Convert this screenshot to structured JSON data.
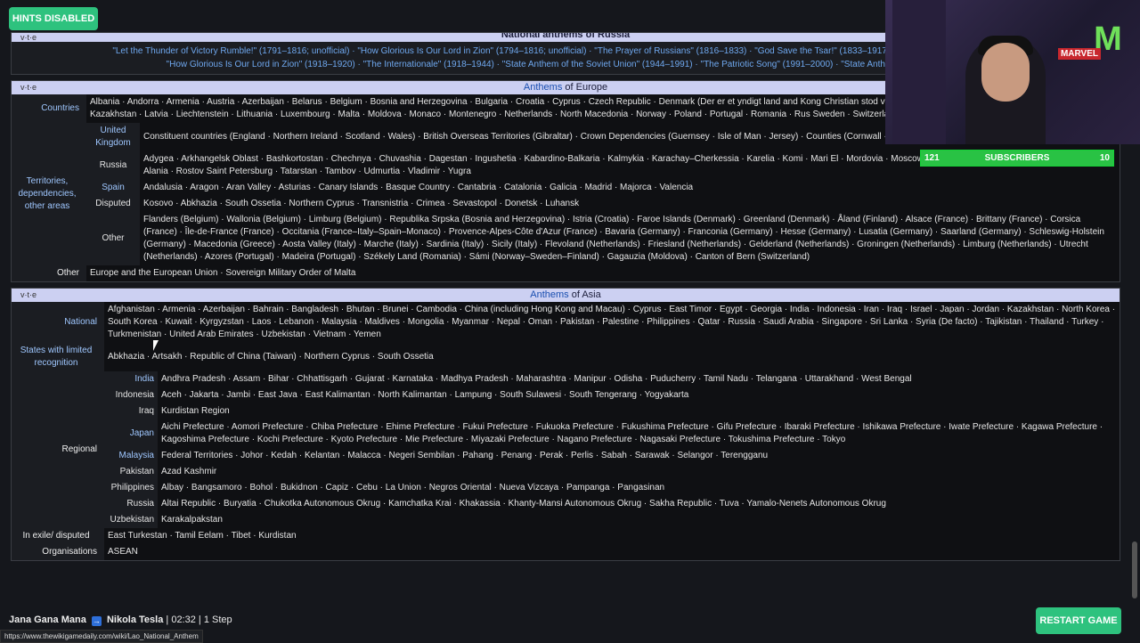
{
  "overlay": {
    "hints": "HINTS DISABLED",
    "restart": "RESTART GAME",
    "subs_left": "121",
    "subs_center": "SUBSCRIBERS",
    "subs_right": "10",
    "cam_logo": "M",
    "cam_marvel": "MARVEL"
  },
  "game": {
    "start": "Jana Gana Mana",
    "arrow": "→",
    "target": "Nikola Tesla",
    "rest": "| 02:32 | 1 Step"
  },
  "status_url": "https://www.thewikigamedaily.com/wiki/Lao_National_Anthem",
  "vte": "v·t·e",
  "russia": {
    "title": "National anthems of Russia",
    "line1": "\"Let the Thunder of Victory Rumble!\" (1791–1816; unofficial) · \"How Glorious Is Our Lord in Zion\" (1794–1816; unofficial) · \"The Prayer of Russians\" (1816–1833) · \"God Save the Tsar!\" (1833–1917) · \"Worker's Marseillaise\" (1917–",
    "line2": "\"How Glorious Is Our Lord in Zion\" (1918–1920) · \"The Internationale\" (1918–1944) · \"State Anthem of the Soviet Union\" (1944–1991) · \"The Patriotic Song\" (1991–2000) · \"State Anthem of the Russian F"
  },
  "europe": {
    "title_a": "Anthems",
    "title_b": "of Europe",
    "countries_label": "Countries",
    "countries": "Albania · Andorra · Armenia · Austria · Azerbaijan · Belarus · Belgium · Bosnia and Herzegovina · Bulgaria · Croatia · Cyprus · Czech Republic · Denmark (Der er et yndigt land and Kong Christian stod ved højen mast) Hungary · Iceland · Ireland · Italy · Kazakhstan · Latvia · Liechtenstein · Lithuania · Luxembourg · Malta · Moldova · Monaco · Montenegro · Netherlands · North Macedonia · Norway · Poland · Portugal · Romania · Rus Sweden · Switzerland · Turkey · Ukraine · United Kingdom · Vatican City",
    "territories_label": "Territories, dependencies, other areas",
    "uk_label": "United Kingdom",
    "uk": "Constituent countries (England · Northern Ireland · Scotland · Wales) · British Overseas Territories (Gibraltar) · Crown Dependencies (Guernsey · Isle of Man · Jersey) · Counties (Cornwall · Lincolnshire · Sussex",
    "russia_label": "Russia",
    "russia": "Adygea · Arkhangelsk Oblast · Bashkortostan · Chechnya · Chuvashia · Dagestan · Ingushetia · Kabardino-Balkaria · Kalmykia · Karachay–Cherkessia · Karelia · Komi · Mari El · Mordovia · Moscow · Nenets Autonomous Okrug · North Ossetia–Alania · Rostov Saint Petersburg · Tatarstan · Tambov · Udmurtia · Vladimir · Yugra",
    "spain_label": "Spain",
    "spain": "Andalusia · Aragon · Aran Valley · Asturias · Canary Islands · Basque Country · Cantabria · Catalonia · Galicia · Madrid · Majorca · Valencia",
    "disputed_label": "Disputed",
    "disputed": "Kosovo · Abkhazia · South Ossetia · Northern Cyprus · Transnistria · Crimea · Sevastopol · Donetsk · Luhansk",
    "other_label": "Other",
    "other": "Flanders (Belgium) · Wallonia (Belgium) · Limburg (Belgium) · Republika Srpska (Bosnia and Herzegovina) · Istria (Croatia) · Faroe Islands (Denmark) · Greenland (Denmark) · Åland (Finland) · Alsace (France) · Brittany (France) · Corsica (France) · Île-de-France (France) · Occitania (France–Italy–Spain–Monaco) · Provence-Alpes-Côte d'Azur (France) · Bavaria (Germany) · Franconia (Germany) · Hesse (Germany) · Lusatia (Germany) · Saarland (Germany) · Schleswig-Holstein (Germany) · Macedonia (Greece) · Aosta Valley (Italy) · Marche (Italy) · Sardinia (Italy) · Sicily (Italy) · Flevoland (Netherlands) · Friesland (Netherlands) · Gelderland (Netherlands) · Groningen (Netherlands) · Limburg (Netherlands) · Utrecht (Netherlands) · Azores (Portugal) · Madeira (Portugal) · Székely Land (Romania) · Sámi (Norway–Sweden–Finland) · Gagauzia (Moldova) · Canton of Bern (Switzerland)",
    "other2_label": "Other",
    "other2": "Europe and the European Union · Sovereign Military Order of Malta"
  },
  "asia": {
    "title_a": "Anthems",
    "title_b": "of Asia",
    "national_label": "National",
    "national": "Afghanistan · Armenia · Azerbaijan · Bahrain · Bangladesh · Bhutan · Brunei · Cambodia · China (including Hong Kong and Macau) · Cyprus · East Timor · Egypt · Georgia · India · Indonesia · Iran · Iraq · Israel · Japan · Jordan · Kazakhstan · North Korea · South Korea · Kuwait · Kyrgyzstan · Laos · Lebanon · Malaysia · Maldives · Mongolia · Myanmar · Nepal · Oman · Pakistan · Palestine · Philippines · Qatar · Russia · Saudi Arabia · Singapore · Sri Lanka · Syria (De facto) · Tajikistan · Thailand · Turkey · Turkmenistan · United Arab Emirates · Uzbekistan · Vietnam · Yemen",
    "limited_label": "States with limited recognition",
    "limited": "Abkhazia · Artsakh · Republic of China (Taiwan) · Northern Cyprus · South Ossetia",
    "regional_label": "Regional",
    "india_label": "India",
    "india": "Andhra Pradesh · Assam · Bihar · Chhattisgarh · Gujarat · Karnataka · Madhya Pradesh · Maharashtra · Manipur · Odisha · Puducherry · Tamil Nadu · Telangana · Uttarakhand · West Bengal",
    "indonesia_label": "Indonesia",
    "indonesia": "Aceh · Jakarta · Jambi · East Java · East Kalimantan · North Kalimantan · Lampung · South Sulawesi · South Tengerang · Yogyakarta",
    "iraq_label": "Iraq",
    "iraq": "Kurdistan Region",
    "japan_label": "Japan",
    "japan": "Aichi Prefecture · Aomori Prefecture · Chiba Prefecture · Ehime Prefecture · Fukui Prefecture · Fukuoka Prefecture · Fukushima Prefecture · Gifu Prefecture · Ibaraki Prefecture · Ishikawa Prefecture · Iwate Prefecture · Kagawa Prefecture · Kagoshima Prefecture · Kochi Prefecture · Kyoto Prefecture · Mie Prefecture · Miyazaki Prefecture · Nagano Prefecture · Nagasaki Prefecture · Tokushima Prefecture · Tokyo",
    "malaysia_label": "Malaysia",
    "malaysia": "Federal Territories · Johor · Kedah · Kelantan · Malacca · Negeri Sembilan · Pahang · Penang · Perak · Perlis · Sabah · Sarawak · Selangor · Terengganu",
    "pakistan_label": "Pakistan",
    "pakistan": "Azad Kashmir",
    "philippines_label": "Philippines",
    "philippines": "Albay · Bangsamoro · Bohol · Bukidnon · Capiz · Cebu · La Union · Negros Oriental · Nueva Vizcaya · Pampanga · Pangasinan",
    "russia_label": "Russia",
    "russia": "Altai Republic · Buryatia · Chukotka Autonomous Okrug · Kamchatka Krai · Khakassia · Khanty-Mansi Autonomous Okrug · Sakha Republic · Tuva · Yamalo-Nenets Autonomous Okrug",
    "uzbekistan_label": "Uzbekistan",
    "uzbekistan": "Karakalpakstan",
    "exile_label": "In exile/ disputed",
    "exile": "East Turkestan · Tamil Eelam · Tibet · Kurdistan",
    "orgs_label": "Organisations",
    "orgs": "ASEAN"
  }
}
